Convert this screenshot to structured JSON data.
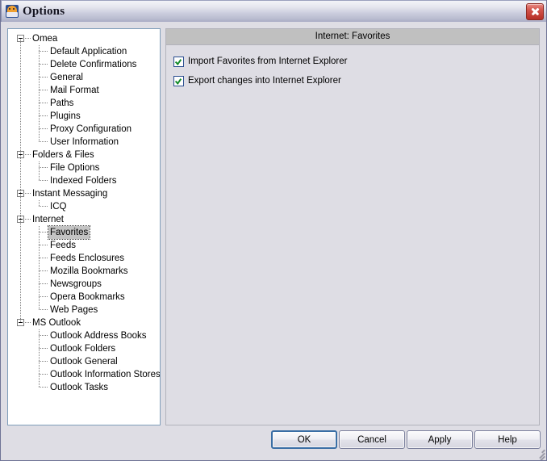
{
  "window": {
    "title": "Options",
    "icon": "omea-app-icon",
    "close_label": "Close"
  },
  "tree": {
    "selected": "Favorites",
    "nodes": [
      {
        "label": "Omea",
        "depth": 0,
        "expanded": true
      },
      {
        "label": "Default Application",
        "depth": 1
      },
      {
        "label": "Delete Confirmations",
        "depth": 1
      },
      {
        "label": "General",
        "depth": 1
      },
      {
        "label": "Mail Format",
        "depth": 1
      },
      {
        "label": "Paths",
        "depth": 1
      },
      {
        "label": "Plugins",
        "depth": 1
      },
      {
        "label": "Proxy Configuration",
        "depth": 1
      },
      {
        "label": "User Information",
        "depth": 1
      },
      {
        "label": "Folders & Files",
        "depth": 0,
        "expanded": true
      },
      {
        "label": "File Options",
        "depth": 1
      },
      {
        "label": "Indexed Folders",
        "depth": 1
      },
      {
        "label": "Instant Messaging",
        "depth": 0,
        "expanded": true
      },
      {
        "label": "ICQ",
        "depth": 1
      },
      {
        "label": "Internet",
        "depth": 0,
        "expanded": true
      },
      {
        "label": "Favorites",
        "depth": 1,
        "selected": true
      },
      {
        "label": "Feeds",
        "depth": 1
      },
      {
        "label": "Feeds Enclosures",
        "depth": 1
      },
      {
        "label": "Mozilla Bookmarks",
        "depth": 1
      },
      {
        "label": "Newsgroups",
        "depth": 1
      },
      {
        "label": "Opera Bookmarks",
        "depth": 1
      },
      {
        "label": "Web Pages",
        "depth": 1
      },
      {
        "label": "MS Outlook",
        "depth": 0,
        "expanded": true
      },
      {
        "label": "Outlook Address Books",
        "depth": 1
      },
      {
        "label": "Outlook Folders",
        "depth": 1
      },
      {
        "label": "Outlook General",
        "depth": 1
      },
      {
        "label": "Outlook Information Stores",
        "depth": 1
      },
      {
        "label": "Outlook Tasks",
        "depth": 1
      }
    ]
  },
  "panel": {
    "header": "Internet: Favorites",
    "options": [
      {
        "label": "Import Favorites from Internet Explorer",
        "checked": true
      },
      {
        "label": "Export changes into Internet Explorer",
        "checked": true
      }
    ]
  },
  "buttons": {
    "ok": "OK",
    "cancel": "Cancel",
    "apply": "Apply",
    "help": "Help"
  },
  "colors": {
    "dialog_face": "#dedde4",
    "panel_header": "#c0c0c0",
    "tree_background": "#ffffff",
    "tree_border": "#7f9db9",
    "selection": "#c3c3c3",
    "default_button_border": "#3a6ea5",
    "checkbox_border": "#2a4d8f",
    "check_mark": "#138a2a",
    "close_button": "#b62f26"
  }
}
